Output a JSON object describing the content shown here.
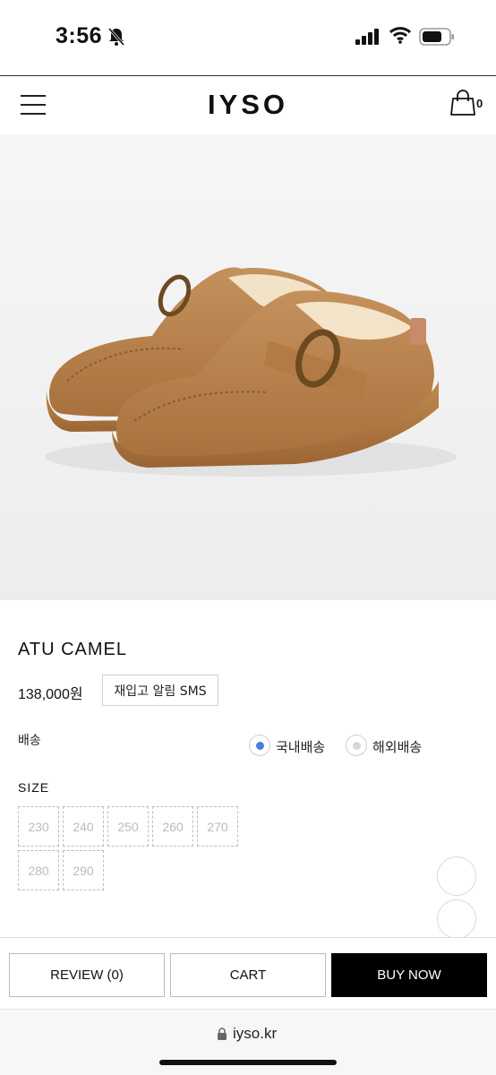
{
  "status_bar": {
    "time": "3:56",
    "icons": [
      "bell-slash-icon",
      "cellular-signal-icon",
      "wifi-icon",
      "battery-icon"
    ]
  },
  "header": {
    "logo": "IYSO",
    "cart_count": "0",
    "icons": [
      "hamburger-menu-icon",
      "shopping-bag-icon"
    ]
  },
  "product": {
    "name": "ATU CAMEL",
    "price": "138,000원",
    "restock_button": "재입고 알림 SMS",
    "image_subject": "camel-shoes"
  },
  "shipping": {
    "label": "배송",
    "options": [
      {
        "label": "국내배송",
        "selected": true
      },
      {
        "label": "해외배송",
        "selected": false
      }
    ]
  },
  "size": {
    "label": "SIZE",
    "options": [
      "230",
      "240",
      "250",
      "260",
      "270",
      "280",
      "290"
    ]
  },
  "actions": {
    "review": "REVIEW (0)",
    "cart": "CART",
    "buy_now": "BUY NOW"
  },
  "browser": {
    "url": "iyso.kr"
  },
  "colors": {
    "accent": "#4a7fd4",
    "buy_button": "#000000",
    "suede": "#b17c47"
  }
}
